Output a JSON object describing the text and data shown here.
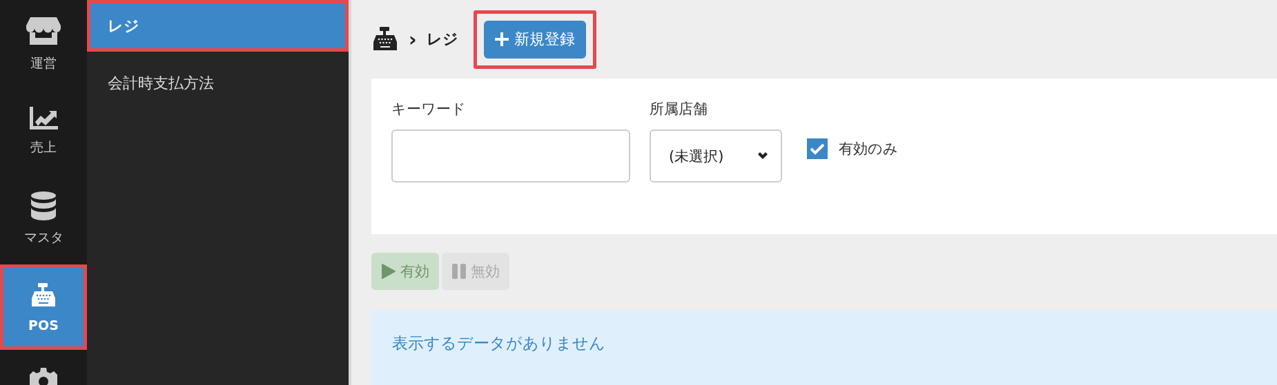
{
  "nav_rail": {
    "items": [
      {
        "label": "運営",
        "selected": false,
        "highlighted": false
      },
      {
        "label": "売上",
        "selected": false,
        "highlighted": false
      },
      {
        "label": "マスタ",
        "selected": false,
        "highlighted": false
      },
      {
        "label": "POS",
        "selected": true,
        "highlighted": true
      },
      {
        "selected": false,
        "highlighted": false
      }
    ]
  },
  "submenu": {
    "items": [
      {
        "label": "レジ",
        "selected": true,
        "highlighted": true
      },
      {
        "label": "会計時支払方法",
        "selected": false,
        "highlighted": false
      }
    ]
  },
  "header": {
    "breadcrumb": [
      {
        "separator": "›",
        "label": "レジ"
      }
    ],
    "new_button": {
      "label": "新規登録",
      "highlighted": true
    }
  },
  "filters": {
    "keyword": {
      "label": "キーワード"
    },
    "store": {
      "label": "所属店舗",
      "value": "(未選択)"
    },
    "active_only": {
      "label": "有効のみ",
      "checked": true
    }
  },
  "actions": [
    {
      "kind": "play",
      "label": "有効",
      "disabled": true
    },
    {
      "kind": "pause",
      "label": "無効",
      "disabled": true
    }
  ],
  "message": "表示するデータがありません"
}
